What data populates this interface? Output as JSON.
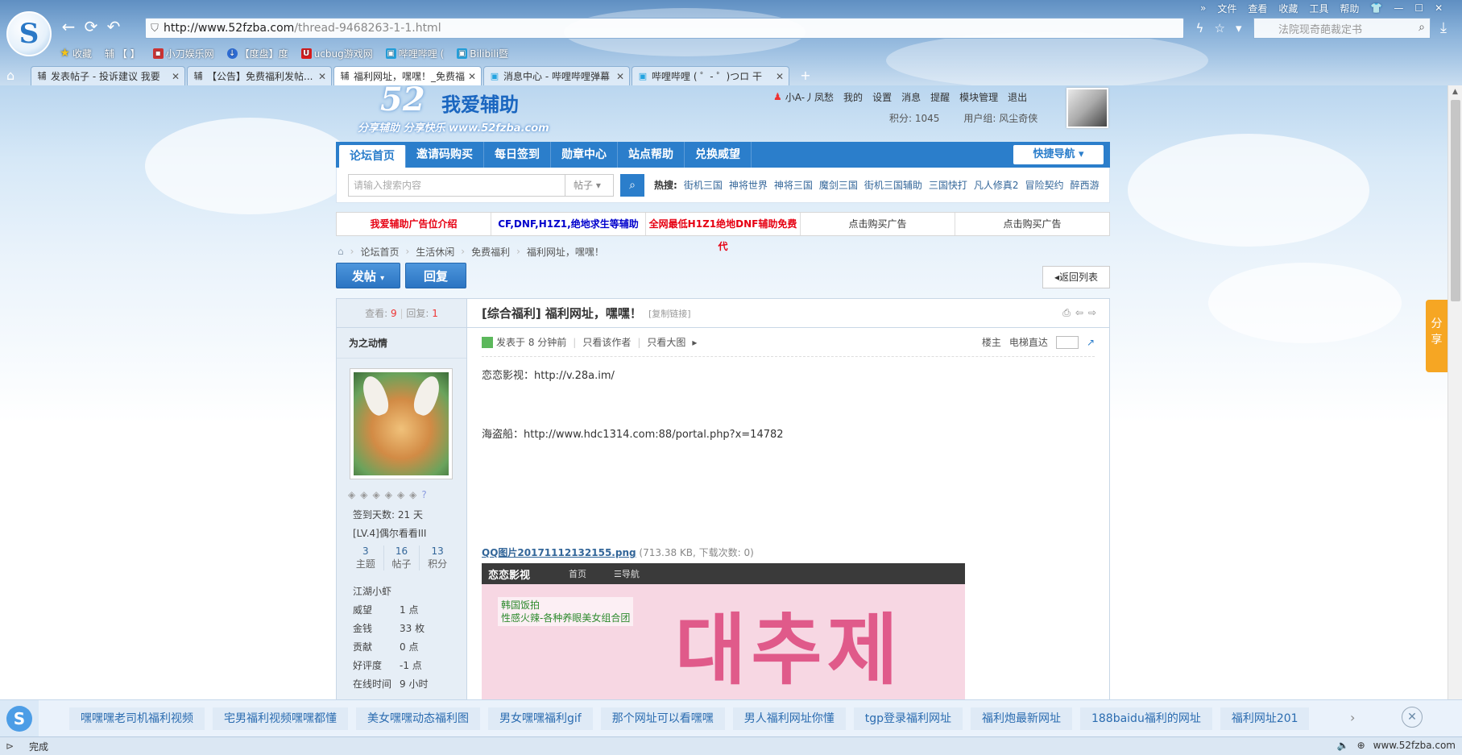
{
  "browser": {
    "url_host": "http://www.52fzba.com",
    "url_path": "/thread-9468263-1-1.html",
    "top_menu": [
      "文件",
      "查看",
      "收藏",
      "工具",
      "帮助"
    ],
    "search_placeholder": "法院现奇葩裁定书",
    "bookmarks": [
      {
        "label": "收藏",
        "icon": "star-icon"
      },
      {
        "label": "辅 【       】",
        "icon": "page-icon"
      },
      {
        "label": "小刀娱乐网",
        "icon": "page-icon"
      },
      {
        "label": "【度盘】度",
        "icon": "baidu-icon"
      },
      {
        "label": "ucbug游戏网",
        "icon": "u-icon"
      },
      {
        "label": "哔哩哔哩 (",
        "icon": "bilibili-icon"
      },
      {
        "label": "Bilibili暨",
        "icon": "bilibili-icon"
      }
    ],
    "tabs": [
      {
        "title": "发表帖子 - 投诉建议 我要",
        "icon": "辅"
      },
      {
        "title": "【公告】免费福利发帖...",
        "icon": "辅"
      },
      {
        "title": "福利网址，嘿嘿！_免费福",
        "icon": "辅"
      },
      {
        "title": "消息中心 - 哔哩哔哩弹幕",
        "icon": "tv"
      },
      {
        "title": "哔哩哔哩 ( ゜- ゜)つロ 干",
        "icon": "tv"
      }
    ]
  },
  "site": {
    "logo_num": "52",
    "logo_name": "我爱辅助",
    "logo_slogan": "分享辅助  分享快乐  www.52fzba.com",
    "user": {
      "name": "小A-丿凤愁",
      "links": [
        "我的",
        "设置",
        "消息",
        "提醒",
        "模块管理",
        "退出"
      ],
      "points": "积分: 1045",
      "group": "用户组: 风尘奇侠"
    },
    "nav": [
      "论坛首页",
      "邀请码购买",
      "每日签到",
      "勋章中心",
      "站点帮助",
      "兑换威望"
    ],
    "quick_nav": "快捷导航",
    "search": {
      "placeholder": "请输入搜索内容",
      "type": "帖子",
      "hot_label": "热搜:",
      "hot": [
        "街机三国",
        "神将世界",
        "神将三国",
        "魔剑三国",
        "街机三国辅助",
        "三国快打",
        "凡人修真2",
        "冒险契约",
        "醉西游"
      ]
    },
    "ads": [
      {
        "text": "我爱辅助广告位介绍",
        "color": "#e60012"
      },
      {
        "text": "CF,DNF,H1Z1,绝地求生等辅助",
        "color": "#0000cc"
      },
      {
        "text": "全网最低H1Z1绝地DNF辅助免费代",
        "color": "#e60012"
      },
      {
        "text": "点击购买广告",
        "color": "#333333"
      },
      {
        "text": "点击购买广告",
        "color": "#333333"
      }
    ],
    "breadcrumb": [
      "论坛首页",
      "生活休闲",
      "免费福利",
      "福利网址，嘿嘿！"
    ],
    "post_btn": "发帖",
    "reply_btn": "回复",
    "back_list": "返回列表",
    "share": "分享"
  },
  "thread": {
    "views_label": "查看:",
    "views": "9",
    "replies_label": "回复:",
    "replies": "1",
    "author": "为之动情",
    "sign_days": "签到天数: 21 天",
    "level": "[LV.4]偶尔看看III",
    "counts": [
      {
        "value": "3",
        "label": "主题"
      },
      {
        "value": "16",
        "label": "帖子"
      },
      {
        "value": "13",
        "label": "积分"
      }
    ],
    "rank": "江湖小虾",
    "props": [
      {
        "k": "威望",
        "v": "1 点"
      },
      {
        "k": "金钱",
        "v": "33 枚"
      },
      {
        "k": "贡献",
        "v": "0 点"
      },
      {
        "k": "好评度",
        "v": "-1 点"
      },
      {
        "k": "在线时间",
        "v": "9 小时"
      }
    ],
    "title": "[综合福利] 福利网址，嘿嘿！",
    "copy_link": "[复制链接]",
    "posted": "发表于 8 分钟前",
    "only_author": "只看该作者",
    "big_image": "只看大图",
    "floor": "楼主",
    "goto_floor": "电梯直达",
    "line1": "恋恋影视：http://v.28a.im/",
    "line2": "海盗船：http://www.hdc1314.com:88/portal.php?x=14782",
    "attach_name": "QQ图片20171112132155.png",
    "attach_info": "(713.38 KB, 下载次数: 0)",
    "image_brand": "恋恋影视",
    "image_nav1": "首页",
    "image_nav2": "☰导航",
    "image_caption1": "韩国饭拍",
    "image_caption2": "性感火辣-各种养眼美女组合团",
    "image_text": "대추제"
  },
  "bottom_bar": {
    "links": [
      "嘿嘿嘿老司机福利视频",
      "宅男福利视频嘿嘿都懂",
      "美女嘿嘿动态福利图",
      "男女嘿嘿福利gif",
      "那个网址可以看嘿嘿",
      "男人福利网址你懂",
      "tgp登录福利网址",
      "福利炮最新网址",
      "188baidu福利的网址",
      "福利网址201"
    ]
  },
  "status": {
    "text": "完成",
    "right": "www.52fzba.com"
  }
}
